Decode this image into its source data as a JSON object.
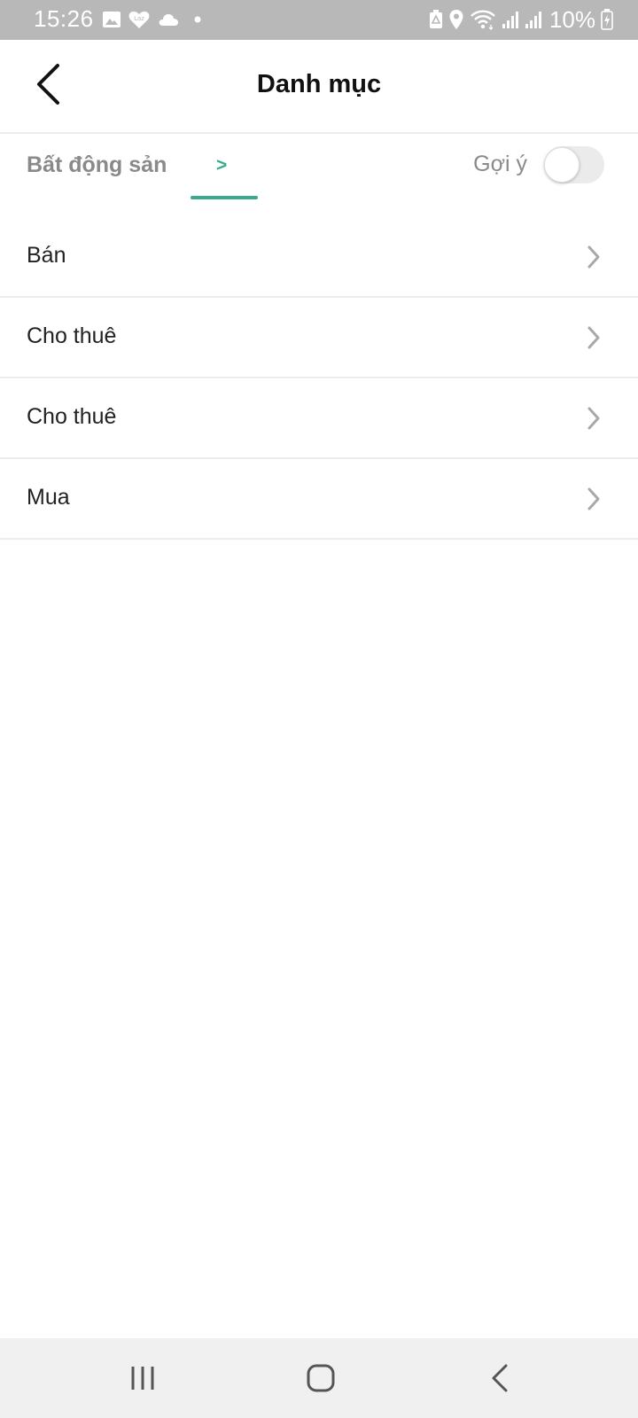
{
  "status_bar": {
    "time": "15:26",
    "battery_percent": "10%",
    "left_icons": [
      "gallery-icon",
      "lazada-icon",
      "cloud-icon",
      "dot-icon"
    ],
    "right_icons": [
      "battery-saver-icon",
      "location-icon",
      "wifi-icon",
      "signal-icon",
      "signal-icon",
      "battery-charging-icon"
    ]
  },
  "header": {
    "title": "Danh mục",
    "back_icon": "chevron-left-icon"
  },
  "breadcrumb": {
    "root": "Bất động sản",
    "separator": ">",
    "accent_color": "#3aaa8f"
  },
  "suggest": {
    "label": "Gợi ý",
    "enabled": false
  },
  "categories": [
    {
      "label": "Bán"
    },
    {
      "label": "Cho thuê"
    },
    {
      "label": "Cho thuê"
    },
    {
      "label": "Mua"
    }
  ],
  "nav_bar": {
    "buttons": [
      "recent-apps-icon",
      "home-icon",
      "back-icon"
    ]
  }
}
